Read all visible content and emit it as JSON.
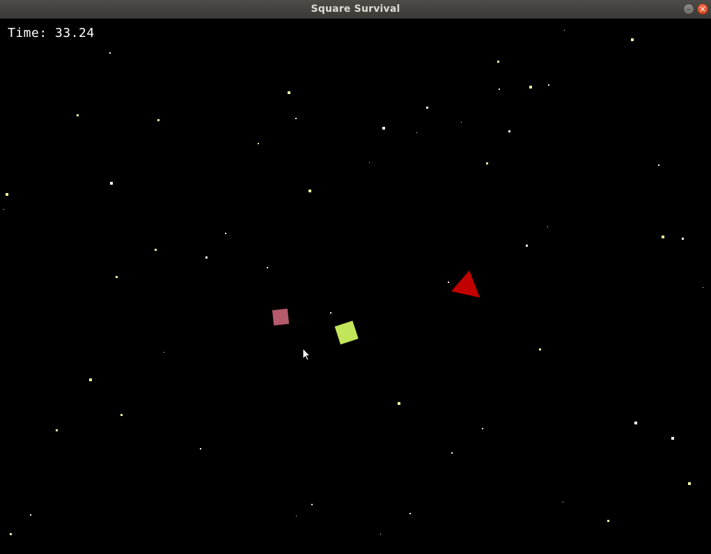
{
  "window": {
    "title": "Square Survival",
    "minimize_symbol": "–",
    "close_symbol": "×"
  },
  "hud": {
    "time_label": "Time:",
    "time_value": "33.24"
  },
  "colors": {
    "background": "#000000",
    "player": "#c2e65a",
    "enemy_square": "#b45a6a",
    "enemy_triangle": "#c20000",
    "star_white": "#ffffff",
    "star_yellow": "#f2f5a0"
  },
  "icons": {
    "cursor": "arrow-cursor-icon",
    "minimize": "minimize-icon",
    "close": "close-icon"
  }
}
